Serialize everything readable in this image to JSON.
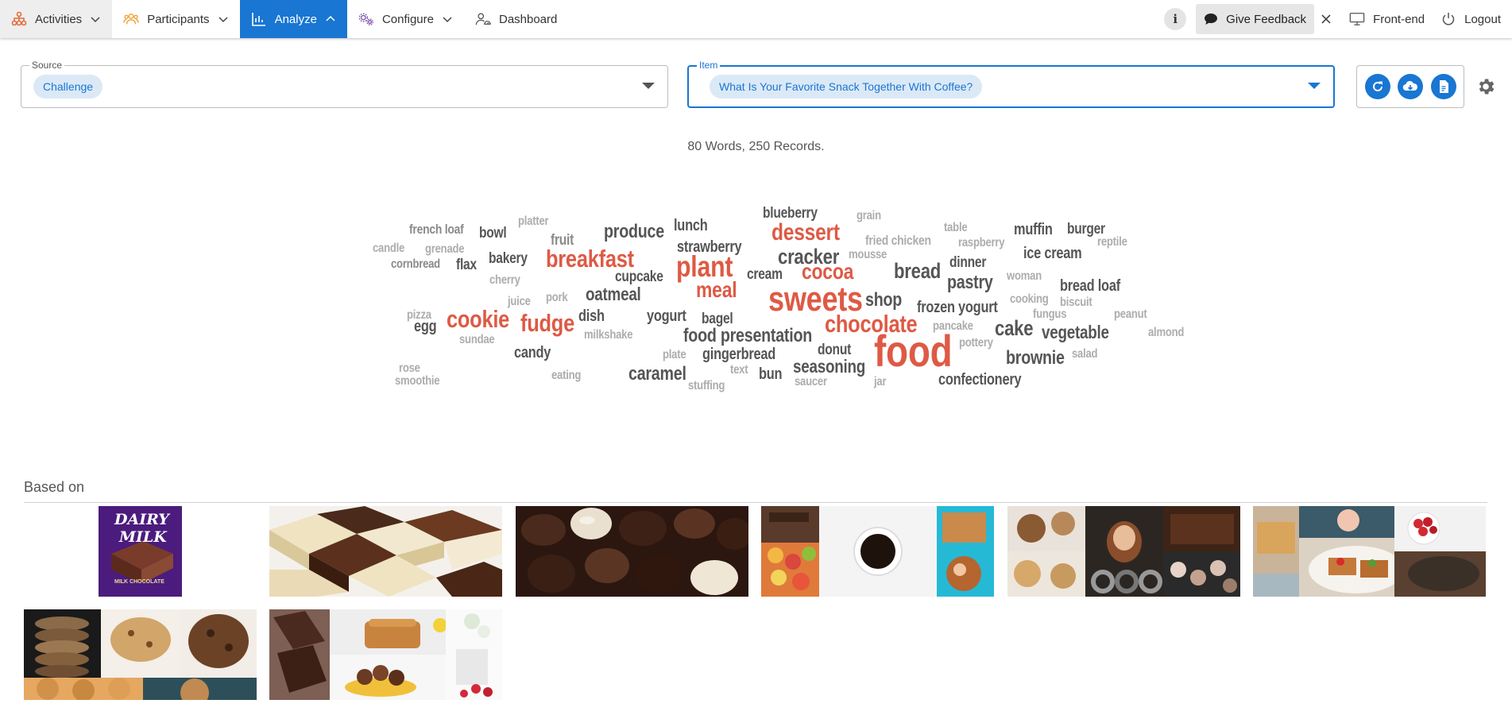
{
  "nav": {
    "items": [
      {
        "label": "Activities",
        "icon": "activities-icon"
      },
      {
        "label": "Participants",
        "icon": "participants-icon"
      },
      {
        "label": "Analyze",
        "icon": "chart-icon"
      },
      {
        "label": "Configure",
        "icon": "configure-icon"
      },
      {
        "label": "Dashboard",
        "icon": "dashboard-icon"
      }
    ],
    "info_label": "i",
    "feedback_label": "Give Feedback",
    "frontend_label": "Front-end",
    "logout_label": "Logout"
  },
  "source": {
    "legend": "Source",
    "chip": "Challenge"
  },
  "item": {
    "legend": "Item",
    "chip": "What Is Your Favorite Snack Together With Coffee?"
  },
  "summary": "80 Words, 250 Records.",
  "colors": {
    "accent": "#1976d2",
    "highlight_word": "#de5a45",
    "word_dark": "#555555",
    "word_light": "#adadad"
  },
  "wordcloud": [
    {
      "t": "french loaf",
      "c": "mid"
    },
    {
      "t": "platter",
      "c": "light"
    },
    {
      "t": "bowl",
      "c": "dark"
    },
    {
      "t": "fruit",
      "c": "mid"
    },
    {
      "t": "produce",
      "c": "dark"
    },
    {
      "t": "lunch",
      "c": "dark"
    },
    {
      "t": "blueberry",
      "c": "dark"
    },
    {
      "t": "grain",
      "c": "light"
    },
    {
      "t": "dessert",
      "c": "red"
    },
    {
      "t": "table",
      "c": "light"
    },
    {
      "t": "muffin",
      "c": "dark"
    },
    {
      "t": "burger",
      "c": "dark"
    },
    {
      "t": "candle",
      "c": "light"
    },
    {
      "t": "grenade",
      "c": "light"
    },
    {
      "t": "cornbread",
      "c": "mid"
    },
    {
      "t": "bakery",
      "c": "dark"
    },
    {
      "t": "flax",
      "c": "dark"
    },
    {
      "t": "breakfast",
      "c": "red"
    },
    {
      "t": "strawberry",
      "c": "dark"
    },
    {
      "t": "fried chicken",
      "c": "light"
    },
    {
      "t": "raspberry",
      "c": "light"
    },
    {
      "t": "reptile",
      "c": "light"
    },
    {
      "t": "cracker",
      "c": "dark"
    },
    {
      "t": "mousse",
      "c": "light"
    },
    {
      "t": "ice cream",
      "c": "dark"
    },
    {
      "t": "dinner",
      "c": "dark"
    },
    {
      "t": "plant",
      "c": "red"
    },
    {
      "t": "cherry",
      "c": "light"
    },
    {
      "t": "cupcake",
      "c": "dark"
    },
    {
      "t": "cream",
      "c": "dark"
    },
    {
      "t": "cocoa",
      "c": "red"
    },
    {
      "t": "bread",
      "c": "dark"
    },
    {
      "t": "woman",
      "c": "light"
    },
    {
      "t": "pastry",
      "c": "dark"
    },
    {
      "t": "bread loaf",
      "c": "dark"
    },
    {
      "t": "meal",
      "c": "red"
    },
    {
      "t": "oatmeal",
      "c": "dark"
    },
    {
      "t": "juice",
      "c": "light"
    },
    {
      "t": "pork",
      "c": "light"
    },
    {
      "t": "sweets",
      "c": "red"
    },
    {
      "t": "shop",
      "c": "dark"
    },
    {
      "t": "cooking",
      "c": "light"
    },
    {
      "t": "biscuit",
      "c": "light"
    },
    {
      "t": "frozen yogurt",
      "c": "dark"
    },
    {
      "t": "pizza",
      "c": "light"
    },
    {
      "t": "egg",
      "c": "dark"
    },
    {
      "t": "cookie",
      "c": "red"
    },
    {
      "t": "fudge",
      "c": "red"
    },
    {
      "t": "dish",
      "c": "dark"
    },
    {
      "t": "yogurt",
      "c": "dark"
    },
    {
      "t": "bagel",
      "c": "dark"
    },
    {
      "t": "chocolate",
      "c": "red"
    },
    {
      "t": "fungus",
      "c": "light"
    },
    {
      "t": "peanut",
      "c": "light"
    },
    {
      "t": "pancake",
      "c": "light"
    },
    {
      "t": "cake",
      "c": "dark"
    },
    {
      "t": "vegetable",
      "c": "dark"
    },
    {
      "t": "almond",
      "c": "light"
    },
    {
      "t": "sundae",
      "c": "light"
    },
    {
      "t": "milkshake",
      "c": "light"
    },
    {
      "t": "food presentation",
      "c": "dark"
    },
    {
      "t": "candy",
      "c": "dark"
    },
    {
      "t": "donut",
      "c": "dark"
    },
    {
      "t": "food",
      "c": "red"
    },
    {
      "t": "pottery",
      "c": "light"
    },
    {
      "t": "brownie",
      "c": "dark"
    },
    {
      "t": "plate",
      "c": "light"
    },
    {
      "t": "gingerbread",
      "c": "dark"
    },
    {
      "t": "salad",
      "c": "light"
    },
    {
      "t": "rose",
      "c": "light"
    },
    {
      "t": "seasoning",
      "c": "dark"
    },
    {
      "t": "text",
      "c": "light"
    },
    {
      "t": "caramel",
      "c": "dark"
    },
    {
      "t": "bun",
      "c": "dark"
    },
    {
      "t": "eating",
      "c": "light"
    },
    {
      "t": "saucer",
      "c": "light"
    },
    {
      "t": "jar",
      "c": "light"
    },
    {
      "t": "confectionery",
      "c": "dark"
    },
    {
      "t": "smoothie",
      "c": "light"
    },
    {
      "t": "stuffing",
      "c": "light"
    }
  ],
  "based_on": {
    "title": "Based on"
  },
  "tiles": [
    {
      "name": "dairy-milk-image",
      "brand_line1": "DAIRY",
      "brand_line2": "MILK",
      "product": "MILK CHOCOLATE"
    },
    {
      "name": "chocolate-bars-image"
    },
    {
      "name": "chocolate-pralines-image"
    },
    {
      "name": "coffee-sweets-collage-image"
    },
    {
      "name": "cookies-donuts-collage-image"
    },
    {
      "name": "breakfast-collage-image"
    },
    {
      "name": "cookies-collage-image"
    },
    {
      "name": "chocolate-cake-collage-image"
    }
  ]
}
